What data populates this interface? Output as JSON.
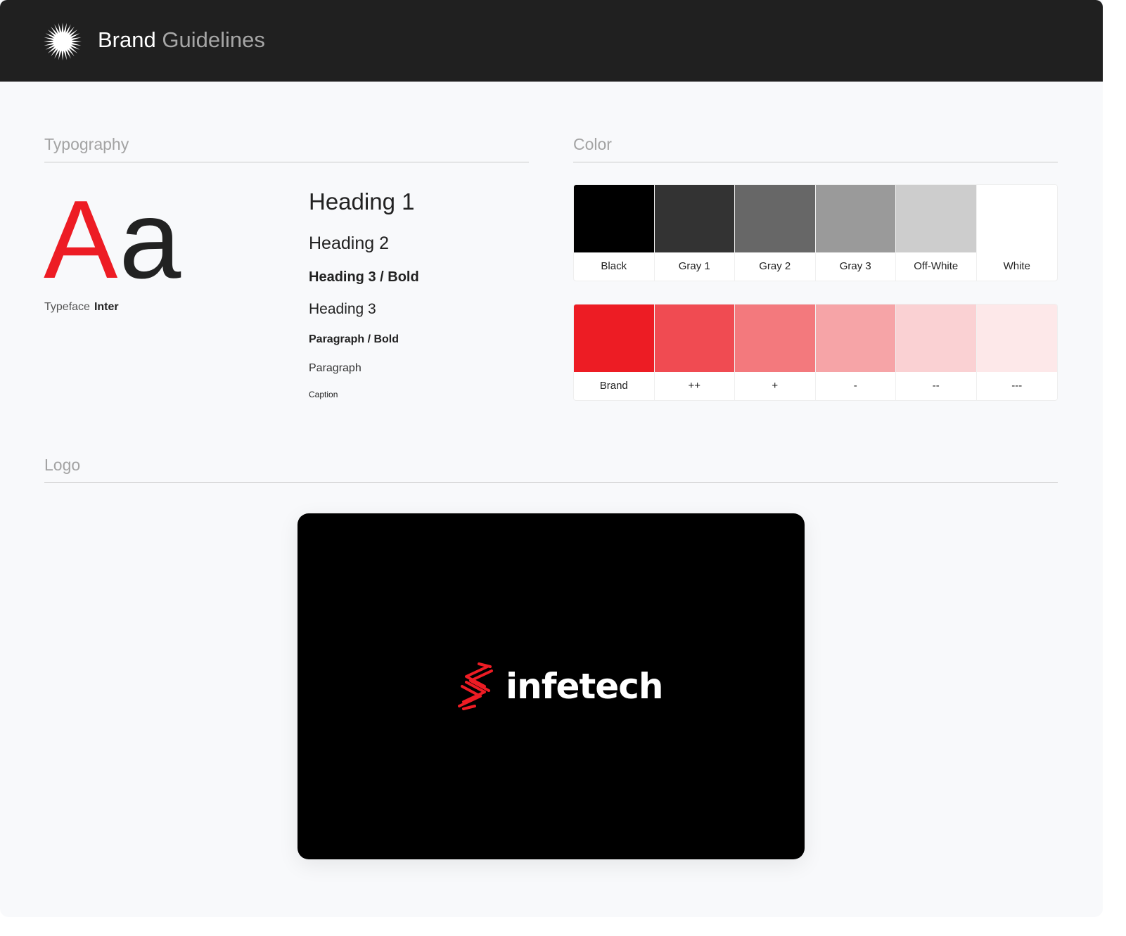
{
  "header": {
    "logo_icon": "starburst-icon",
    "title_part1": "Brand",
    "title_part2": "Guidelines"
  },
  "typography": {
    "section_title": "Typography",
    "specimen_upper": "A",
    "specimen_lower": "a",
    "typeface_label": "Typeface",
    "typeface_name": "Inter",
    "styles": {
      "heading1": "Heading 1",
      "heading2": "Heading 2",
      "heading3_bold": "Heading 3 / Bold",
      "heading3": "Heading 3",
      "paragraph_bold": "Paragraph / Bold",
      "paragraph": "Paragraph",
      "caption": "Caption"
    }
  },
  "color": {
    "section_title": "Color",
    "neutrals": [
      {
        "label": "Black",
        "hex": "#000000"
      },
      {
        "label": "Gray 1",
        "hex": "#333333"
      },
      {
        "label": "Gray 2",
        "hex": "#676767"
      },
      {
        "label": "Gray 3",
        "hex": "#9a9a9a"
      },
      {
        "label": "Off-White",
        "hex": "#cdcdcd"
      },
      {
        "label": "White",
        "hex": "#ffffff"
      }
    ],
    "brand": [
      {
        "label": "Brand",
        "hex": "#ed1c24"
      },
      {
        "label": "++",
        "hex": "#f04b52"
      },
      {
        "label": "+",
        "hex": "#f3797d"
      },
      {
        "label": "-",
        "hex": "#f6a4a7"
      },
      {
        "label": "--",
        "hex": "#fad1d3"
      },
      {
        "label": "---",
        "hex": "#fde8e9"
      }
    ]
  },
  "logo": {
    "section_title": "Logo",
    "wordmark": "infetech",
    "mark_icon": "infetech-s-mark-icon",
    "mark_color": "#ed1c24",
    "background": "#000000"
  }
}
